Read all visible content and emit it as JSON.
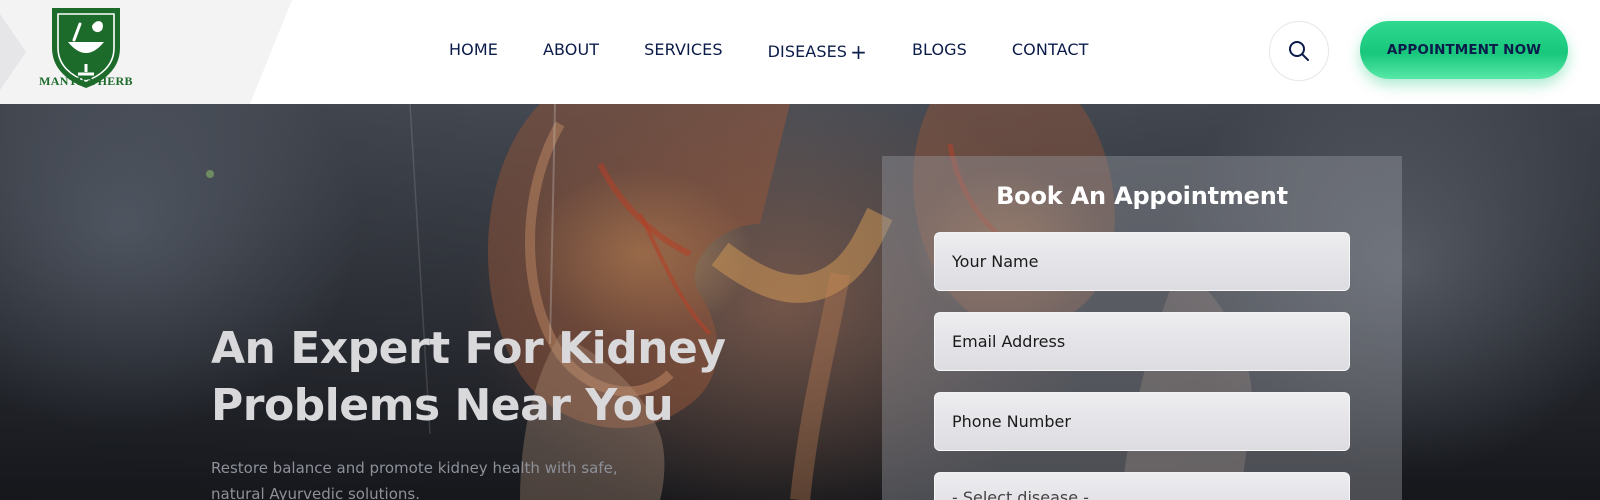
{
  "brand": {
    "name": "MANTRA HERB",
    "logo_icon": "mortar-pestle-shield-icon",
    "brand_color": "#1c6b2a"
  },
  "nav": {
    "items": [
      {
        "label": "HOME"
      },
      {
        "label": "ABOUT"
      },
      {
        "label": "SERVICES"
      },
      {
        "label": "DISEASES"
      },
      {
        "label": "BLOGS"
      },
      {
        "label": "CONTACT"
      }
    ],
    "diseases_expand_icon": "plus-icon"
  },
  "header_actions": {
    "search_icon": "search-icon",
    "appointment_label": "APPOINTMENT NOW",
    "accent_color": "#18c77c"
  },
  "hero": {
    "title_line1": "An Expert For Kidney",
    "title_line2": "Problems Near You",
    "subtitle_line1": "Restore balance and promote kidney health with safe,",
    "subtitle_line2": "natural Ayurvedic solutions."
  },
  "appointment_form": {
    "title": "Book An Appointment",
    "name_placeholder": "Your Name",
    "email_placeholder": "Email Address",
    "phone_placeholder": "Phone Number",
    "disease_select_value": "- Select disease -"
  },
  "text_color": "#0b1b4a"
}
